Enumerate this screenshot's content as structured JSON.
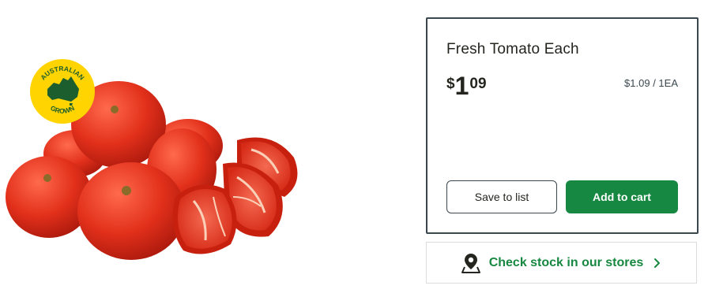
{
  "product": {
    "title": "Fresh Tomato Each",
    "price": {
      "currency": "$",
      "dollars": "1",
      "cents": "09"
    },
    "unit_price": "$1.09 / 1EA",
    "image_alt": "Fresh tomatoes, whole and halved"
  },
  "badge": {
    "top_text": "AUSTRALIAN",
    "bottom_text": "GROWN"
  },
  "actions": {
    "save_label": "Save to list",
    "cart_label": "Add to cart"
  },
  "stock": {
    "label": "Check stock in our stores",
    "icon": "map-pin-icon"
  },
  "colors": {
    "accent_green": "#178841",
    "badge_yellow": "#ffd400",
    "badge_green": "#1d5e2e",
    "tomato_red": "#e1301b",
    "border_dark": "#3a474e"
  }
}
